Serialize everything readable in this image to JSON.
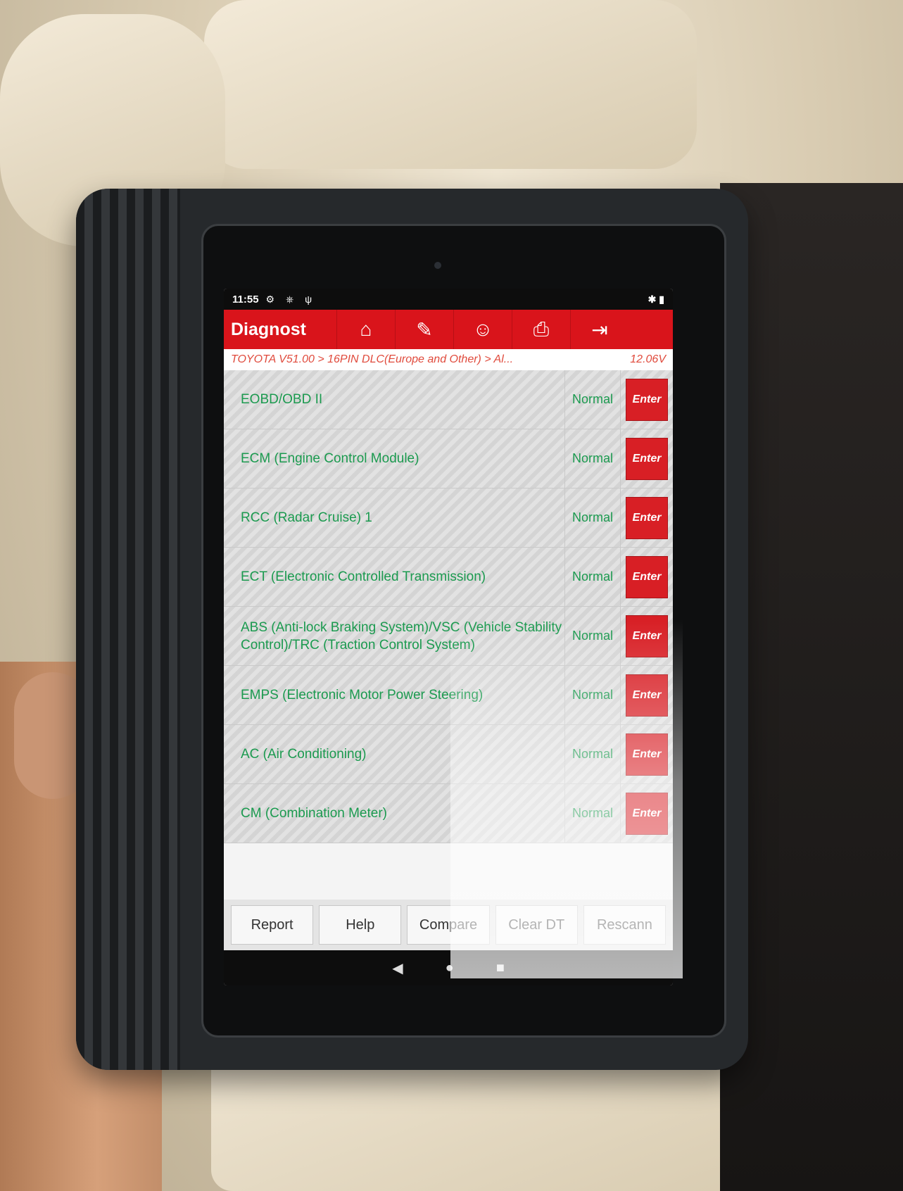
{
  "status_bar": {
    "time": "11:55",
    "icons": "⚙ ⎈ ψ",
    "right_icons": "✱ ▮"
  },
  "app_bar": {
    "title": "Diagnost",
    "tools": [
      {
        "icon": "home-icon",
        "glyph": "⌂"
      },
      {
        "icon": "edit-icon",
        "glyph": "✎"
      },
      {
        "icon": "user-icon",
        "glyph": "☺"
      },
      {
        "icon": "print-icon",
        "glyph": "⎙"
      },
      {
        "icon": "exit-icon",
        "glyph": "⇥"
      }
    ]
  },
  "breadcrumb": {
    "path": "TOYOTA V51.00 > 16PIN DLC(Europe and Other) > Al...",
    "voltage": "12.06V"
  },
  "systems": [
    {
      "name": "EOBD/OBD II",
      "status": "Normal",
      "action": "Enter"
    },
    {
      "name": "ECM (Engine Control Module)",
      "status": "Normal",
      "action": "Enter"
    },
    {
      "name": "RCC (Radar Cruise) 1",
      "status": "Normal",
      "action": "Enter"
    },
    {
      "name": "ECT (Electronic Controlled Transmission)",
      "status": "Normal",
      "action": "Enter"
    },
    {
      "name": "ABS (Anti-lock Braking System)/VSC (Vehicle Stability Control)/TRC (Traction Control System)",
      "status": "Normal",
      "action": "Enter"
    },
    {
      "name": "EMPS (Electronic Motor Power Steering)",
      "status": "Normal",
      "action": "Enter"
    },
    {
      "name": "AC (Air Conditioning)",
      "status": "Normal",
      "action": "Enter"
    },
    {
      "name": "CM (Combination Meter)",
      "status": "Normal",
      "action": "Enter"
    }
  ],
  "bottom_buttons": [
    "Report",
    "Help",
    "Compare",
    "Clear DT",
    "Rescann"
  ],
  "nav": {
    "back": "◀",
    "home": "●",
    "recent": "■"
  }
}
